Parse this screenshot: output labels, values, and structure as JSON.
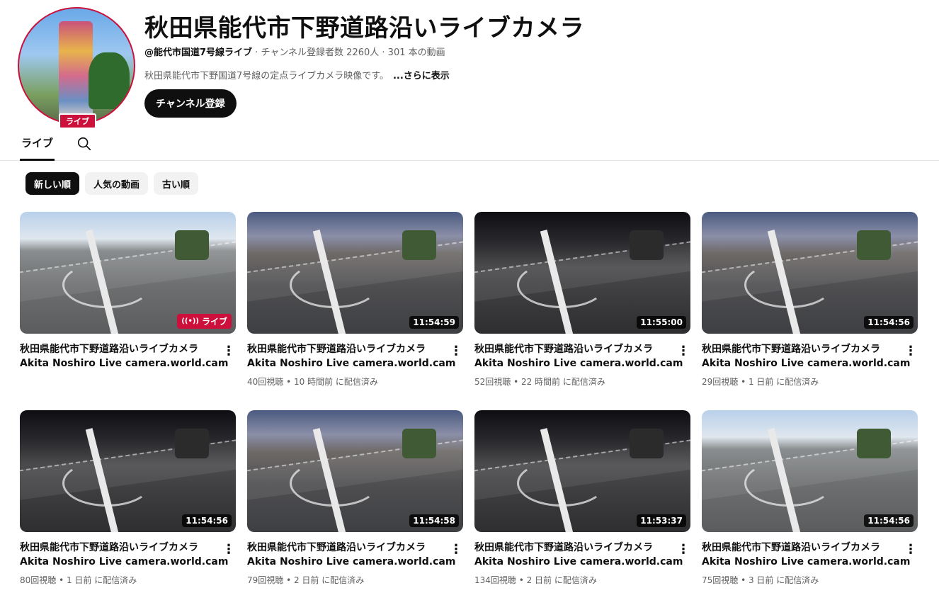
{
  "channel": {
    "title": "秋田県能代市下野道路沿いライブカメラ",
    "handle": "@能代市国道7号線ライブ",
    "meta_rest": " · チャンネル登録者数 2260人 · 301 本の動画",
    "description": "秋田県能代市下野国道7号線の定点ライブカメラ映像です。",
    "more_label": "...さらに表示",
    "subscribe_label": "チャンネル登録",
    "avatar_badge": "ライブ"
  },
  "tabs": {
    "live_label": "ライブ",
    "search_icon": "search-icon"
  },
  "sort_chips": [
    {
      "label": "新しい順",
      "active": true
    },
    {
      "label": "人気の動画",
      "active": false
    },
    {
      "label": "古い順",
      "active": false
    }
  ],
  "videos": [
    {
      "title": "秋田県能代市下野道路沿いライブカメラ",
      "subtitle": "Akita Noshiro Live camera.world.cam",
      "meta": "",
      "duration": "",
      "live_label": "ライブ",
      "scene": "day"
    },
    {
      "title": "秋田県能代市下野道路沿いライブカメラ",
      "subtitle": "Akita Noshiro Live camera.world.cam",
      "meta": "40回視聴 • 10 時間前 に配信済み",
      "duration": "11:54:59",
      "live_label": "",
      "scene": "dusk"
    },
    {
      "title": "秋田県能代市下野道路沿いライブカメラ",
      "subtitle": "Akita Noshiro Live camera.world.cam",
      "meta": "52回視聴 • 22 時間前 に配信済み",
      "duration": "11:55:00",
      "live_label": "",
      "scene": "night"
    },
    {
      "title": "秋田県能代市下野道路沿いライブカメラ",
      "subtitle": "Akita Noshiro Live camera.world.cam",
      "meta": "29回視聴 • 1 日前 に配信済み",
      "duration": "11:54:56",
      "live_label": "",
      "scene": "dusk"
    },
    {
      "title": "秋田県能代市下野道路沿いライブカメラ",
      "subtitle": "Akita Noshiro Live camera.world.cam",
      "meta": "80回視聴 • 1 日前 に配信済み",
      "duration": "11:54:56",
      "live_label": "",
      "scene": "night"
    },
    {
      "title": "秋田県能代市下野道路沿いライブカメラ",
      "subtitle": "Akita Noshiro Live camera.world.cam",
      "meta": "79回視聴 • 2 日前 に配信済み",
      "duration": "11:54:58",
      "live_label": "",
      "scene": "dusk"
    },
    {
      "title": "秋田県能代市下野道路沿いライブカメラ",
      "subtitle": "Akita Noshiro Live camera.world.cam",
      "meta": "134回視聴 • 2 日前 に配信済み",
      "duration": "11:53:37",
      "live_label": "",
      "scene": "night"
    },
    {
      "title": "秋田県能代市下野道路沿いライブカメラ",
      "subtitle": "Akita Noshiro Live camera.world.cam",
      "meta": "75回視聴 • 3 日前 に配信済み",
      "duration": "11:54:56",
      "live_label": "",
      "scene": "day"
    }
  ],
  "colors": {
    "accent_live": "#cc0f3b",
    "text_primary": "#0f0f0f",
    "text_secondary": "#606060",
    "chip_bg": "#f2f2f2"
  }
}
